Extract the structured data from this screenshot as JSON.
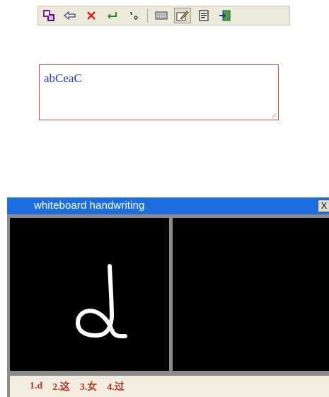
{
  "toolbar": {
    "buttons": [
      {
        "name": "app-logo-icon",
        "pressed": false
      },
      {
        "name": "backspace-arrow-icon",
        "pressed": false
      },
      {
        "name": "delete-x-icon",
        "pressed": false
      },
      {
        "name": "enter-return-icon",
        "pressed": false
      },
      {
        "name": "punctuation-icon",
        "pressed": false
      },
      {
        "name": "keyboard-icon",
        "pressed": false
      },
      {
        "name": "handwriting-pen-icon",
        "pressed": true
      },
      {
        "name": "document-icon",
        "pressed": false
      },
      {
        "name": "exit-icon",
        "pressed": false
      }
    ]
  },
  "input": {
    "value": "abCeaC"
  },
  "whiteboard": {
    "title": "whiteboard handwriting",
    "close_label": "X",
    "stroke_color": "#ffffff",
    "candidates": [
      "1.d",
      "2.这",
      "3.女",
      "4.过"
    ]
  },
  "colors": {
    "titlebar": "#1d6fe0",
    "textbox_border": "#c0504d",
    "text_value": "#2f3aa8",
    "candidate_text": "#b2332a"
  }
}
